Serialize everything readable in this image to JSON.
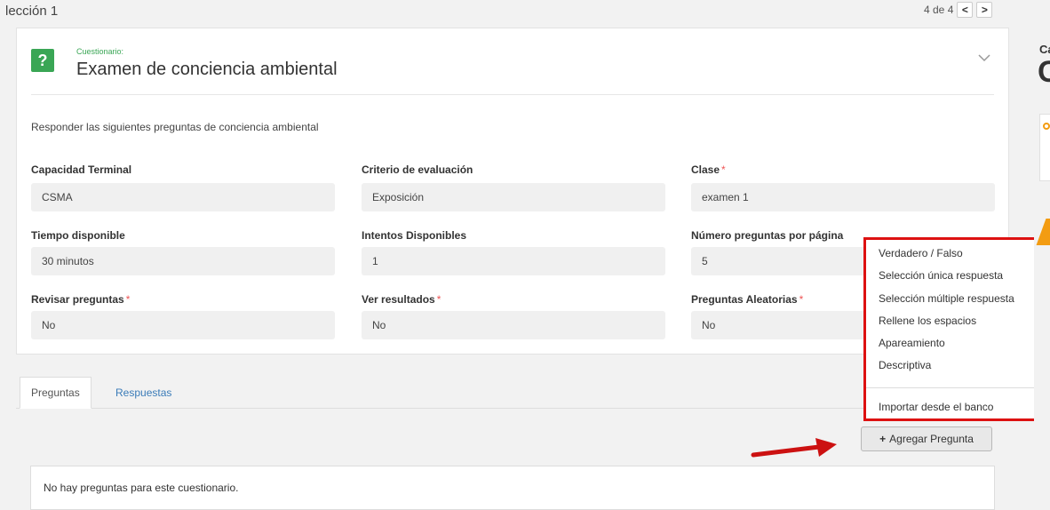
{
  "header": {
    "lesson_title": "lección 1",
    "pager_text": "4 de 4",
    "prev_symbol": "<",
    "next_symbol": ">"
  },
  "quiz": {
    "kind_label": "Cuestionario:",
    "icon_glyph": "?",
    "title": "Examen de conciencia ambiental",
    "description": "Responder las siguientes preguntas de conciencia ambiental",
    "fields": [
      {
        "label": "Capacidad Terminal",
        "required": false,
        "value": "CSMA"
      },
      {
        "label": "Criterio de evaluación",
        "required": false,
        "value": "Exposición"
      },
      {
        "label": "Clase",
        "required": true,
        "value": "examen 1"
      },
      {
        "label": "Tiempo disponible",
        "required": false,
        "value": "30 minutos"
      },
      {
        "label": "Intentos Disponibles",
        "required": false,
        "value": "1"
      },
      {
        "label": "Número preguntas por página",
        "required": false,
        "value": "5"
      },
      {
        "label": "Revisar preguntas",
        "required": true,
        "value": "No"
      },
      {
        "label": "Ver resultados",
        "required": true,
        "value": "No"
      },
      {
        "label": "Preguntas Aleatorias",
        "required": true,
        "value": "No"
      }
    ]
  },
  "tabs": [
    {
      "label": "Preguntas",
      "active": true
    },
    {
      "label": "Respuestas",
      "active": false
    }
  ],
  "add_button": {
    "icon": "+",
    "label": "Agregar Pregunta"
  },
  "dropdown": {
    "items": [
      "Verdadero / Falso",
      "Selección única respuesta",
      "Selección múltiple respuesta",
      "Rellene los espacios",
      "Apareamiento",
      "Descriptiva"
    ],
    "footer_item": "Importar desde el banco"
  },
  "empty_message": "No hay preguntas para este cuestionario.",
  "right_strip": {
    "letter_small": "Ca",
    "letter_large": "C"
  },
  "colors": {
    "accent_green": "#3aa655",
    "highlight_red": "#d11111",
    "link_blue": "#3a7bb8"
  }
}
